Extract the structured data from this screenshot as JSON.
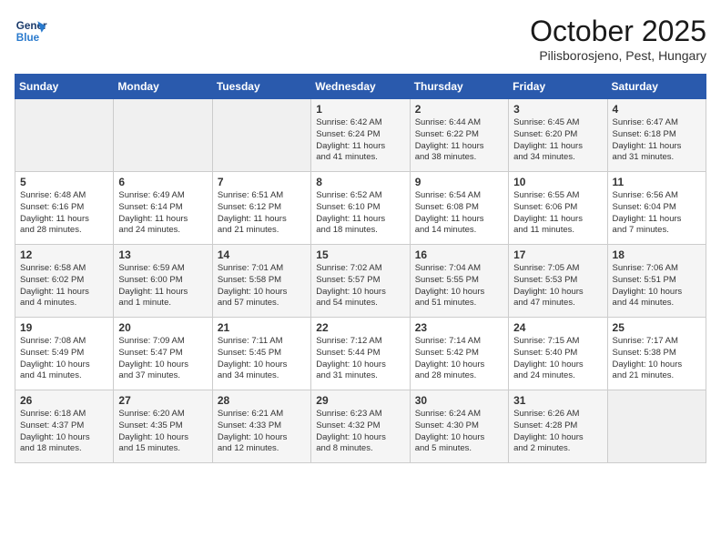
{
  "header": {
    "logo_line1": "General",
    "logo_line2": "Blue",
    "month": "October 2025",
    "location": "Pilisborosjeno, Pest, Hungary"
  },
  "days_of_week": [
    "Sunday",
    "Monday",
    "Tuesday",
    "Wednesday",
    "Thursday",
    "Friday",
    "Saturday"
  ],
  "weeks": [
    [
      {
        "day": "",
        "text": ""
      },
      {
        "day": "",
        "text": ""
      },
      {
        "day": "",
        "text": ""
      },
      {
        "day": "1",
        "text": "Sunrise: 6:42 AM\nSunset: 6:24 PM\nDaylight: 11 hours\nand 41 minutes."
      },
      {
        "day": "2",
        "text": "Sunrise: 6:44 AM\nSunset: 6:22 PM\nDaylight: 11 hours\nand 38 minutes."
      },
      {
        "day": "3",
        "text": "Sunrise: 6:45 AM\nSunset: 6:20 PM\nDaylight: 11 hours\nand 34 minutes."
      },
      {
        "day": "4",
        "text": "Sunrise: 6:47 AM\nSunset: 6:18 PM\nDaylight: 11 hours\nand 31 minutes."
      }
    ],
    [
      {
        "day": "5",
        "text": "Sunrise: 6:48 AM\nSunset: 6:16 PM\nDaylight: 11 hours\nand 28 minutes."
      },
      {
        "day": "6",
        "text": "Sunrise: 6:49 AM\nSunset: 6:14 PM\nDaylight: 11 hours\nand 24 minutes."
      },
      {
        "day": "7",
        "text": "Sunrise: 6:51 AM\nSunset: 6:12 PM\nDaylight: 11 hours\nand 21 minutes."
      },
      {
        "day": "8",
        "text": "Sunrise: 6:52 AM\nSunset: 6:10 PM\nDaylight: 11 hours\nand 18 minutes."
      },
      {
        "day": "9",
        "text": "Sunrise: 6:54 AM\nSunset: 6:08 PM\nDaylight: 11 hours\nand 14 minutes."
      },
      {
        "day": "10",
        "text": "Sunrise: 6:55 AM\nSunset: 6:06 PM\nDaylight: 11 hours\nand 11 minutes."
      },
      {
        "day": "11",
        "text": "Sunrise: 6:56 AM\nSunset: 6:04 PM\nDaylight: 11 hours\nand 7 minutes."
      }
    ],
    [
      {
        "day": "12",
        "text": "Sunrise: 6:58 AM\nSunset: 6:02 PM\nDaylight: 11 hours\nand 4 minutes."
      },
      {
        "day": "13",
        "text": "Sunrise: 6:59 AM\nSunset: 6:00 PM\nDaylight: 11 hours\nand 1 minute."
      },
      {
        "day": "14",
        "text": "Sunrise: 7:01 AM\nSunset: 5:58 PM\nDaylight: 10 hours\nand 57 minutes."
      },
      {
        "day": "15",
        "text": "Sunrise: 7:02 AM\nSunset: 5:57 PM\nDaylight: 10 hours\nand 54 minutes."
      },
      {
        "day": "16",
        "text": "Sunrise: 7:04 AM\nSunset: 5:55 PM\nDaylight: 10 hours\nand 51 minutes."
      },
      {
        "day": "17",
        "text": "Sunrise: 7:05 AM\nSunset: 5:53 PM\nDaylight: 10 hours\nand 47 minutes."
      },
      {
        "day": "18",
        "text": "Sunrise: 7:06 AM\nSunset: 5:51 PM\nDaylight: 10 hours\nand 44 minutes."
      }
    ],
    [
      {
        "day": "19",
        "text": "Sunrise: 7:08 AM\nSunset: 5:49 PM\nDaylight: 10 hours\nand 41 minutes."
      },
      {
        "day": "20",
        "text": "Sunrise: 7:09 AM\nSunset: 5:47 PM\nDaylight: 10 hours\nand 37 minutes."
      },
      {
        "day": "21",
        "text": "Sunrise: 7:11 AM\nSunset: 5:45 PM\nDaylight: 10 hours\nand 34 minutes."
      },
      {
        "day": "22",
        "text": "Sunrise: 7:12 AM\nSunset: 5:44 PM\nDaylight: 10 hours\nand 31 minutes."
      },
      {
        "day": "23",
        "text": "Sunrise: 7:14 AM\nSunset: 5:42 PM\nDaylight: 10 hours\nand 28 minutes."
      },
      {
        "day": "24",
        "text": "Sunrise: 7:15 AM\nSunset: 5:40 PM\nDaylight: 10 hours\nand 24 minutes."
      },
      {
        "day": "25",
        "text": "Sunrise: 7:17 AM\nSunset: 5:38 PM\nDaylight: 10 hours\nand 21 minutes."
      }
    ],
    [
      {
        "day": "26",
        "text": "Sunrise: 6:18 AM\nSunset: 4:37 PM\nDaylight: 10 hours\nand 18 minutes."
      },
      {
        "day": "27",
        "text": "Sunrise: 6:20 AM\nSunset: 4:35 PM\nDaylight: 10 hours\nand 15 minutes."
      },
      {
        "day": "28",
        "text": "Sunrise: 6:21 AM\nSunset: 4:33 PM\nDaylight: 10 hours\nand 12 minutes."
      },
      {
        "day": "29",
        "text": "Sunrise: 6:23 AM\nSunset: 4:32 PM\nDaylight: 10 hours\nand 8 minutes."
      },
      {
        "day": "30",
        "text": "Sunrise: 6:24 AM\nSunset: 4:30 PM\nDaylight: 10 hours\nand 5 minutes."
      },
      {
        "day": "31",
        "text": "Sunrise: 6:26 AM\nSunset: 4:28 PM\nDaylight: 10 hours\nand 2 minutes."
      },
      {
        "day": "",
        "text": ""
      }
    ]
  ]
}
